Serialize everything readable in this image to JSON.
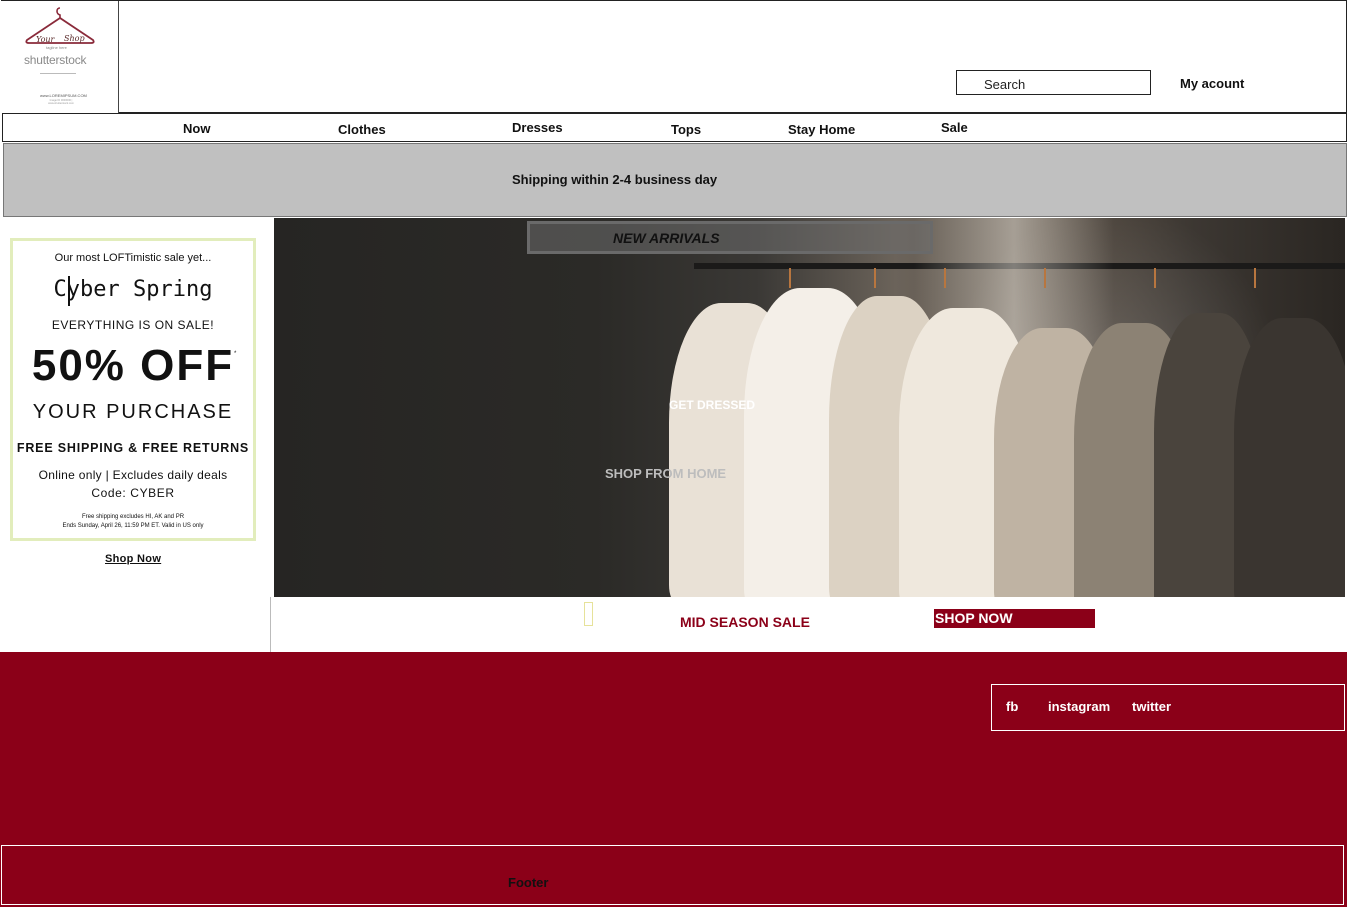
{
  "header": {
    "logo": {
      "script_1": "Your",
      "script_2": "Shop",
      "tagline": "tagline here",
      "watermark": "shutterstock",
      "url": "www.LOREMIPSUM.COM",
      "fine_print": "Image ID 0000000 | www.shutterstock.com"
    },
    "search_placeholder": "Search",
    "account_label": "My acount"
  },
  "nav": {
    "items": [
      "Now",
      "Clothes",
      "Dresses",
      "Tops",
      "Stay Home",
      "Sale"
    ]
  },
  "shipping_banner": {
    "text": "Shipping within 2-4 business day"
  },
  "promo": {
    "tag": "Our most LOFTimistic sale yet...",
    "title": "Cyber Spring",
    "everything": "EVERYTHING IS ON SALE!",
    "discount": "50% OFF",
    "discount_mark": "*",
    "purchase": "YOUR PURCHASE",
    "free": "FREE SHIPPING & FREE RETURNS",
    "online": "Online only | Excludes daily deals",
    "code": "Code: CYBER",
    "fine_1": "Free shipping excludes HI, AK and PR",
    "fine_2": "Ends Sunday, April 26, 11:59 PM ET. Valid in US only",
    "link": "Shop Now",
    "border_color": "#e2edbc"
  },
  "hero": {
    "new_arrivals": "NEW ARRIVALS",
    "get_dressed": "GET DRESSED",
    "shop_from_home": "SHOP FROM HOME"
  },
  "sale_strip": {
    "mid_season": "MID SEASON SALE",
    "shop_now": "SHOP NOW",
    "accent": "#8b0018"
  },
  "social": {
    "fb": "fb",
    "instagram": "instagram",
    "twitter": "twitter"
  },
  "footer": {
    "label": "Footer",
    "background": "#8b0018"
  }
}
